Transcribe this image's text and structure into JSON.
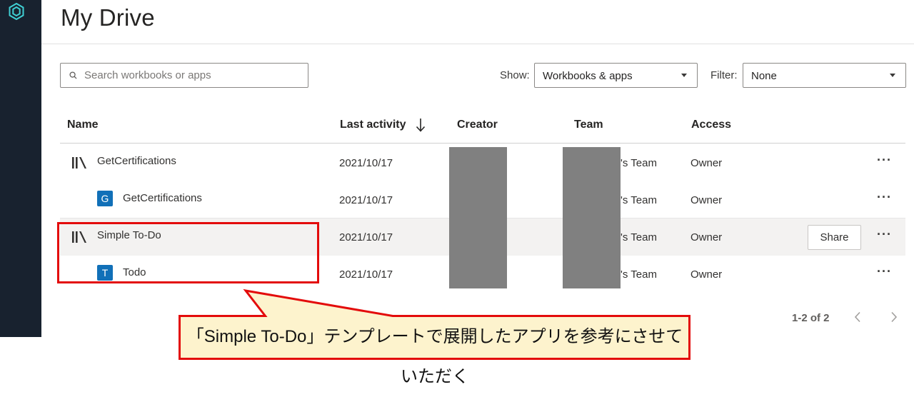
{
  "sidebar": {
    "logo_icon": "hexagon-logo-icon",
    "background": "#18222f"
  },
  "header": {
    "title": "My Drive"
  },
  "toolbar": {
    "search_placeholder": "Search workbooks or apps",
    "show_label": "Show:",
    "show_value": "Workbooks & apps",
    "filter_label": "Filter:",
    "filter_value": "None"
  },
  "table": {
    "columns": {
      "name": "Name",
      "last_activity": "Last activity",
      "creator": "Creator",
      "team": "Team",
      "access": "Access"
    },
    "sort_icon": "arrow-down-icon",
    "rows": [
      {
        "type": "workspace",
        "name": "GetCertifications",
        "last_activity": "2021/10/17",
        "team": "'s Team",
        "access": "Owner"
      },
      {
        "type": "app",
        "badge": "G",
        "name": "GetCertifications",
        "last_activity": "2021/10/17",
        "team": "'s Team",
        "access": "Owner"
      },
      {
        "type": "workspace",
        "name": "Simple To-Do",
        "last_activity": "2021/10/17",
        "team": "'s Team",
        "access": "Owner",
        "share_label": "Share"
      },
      {
        "type": "app",
        "badge": "T",
        "name": "Todo",
        "last_activity": "2021/10/17",
        "team": "'s Team",
        "access": "Owner"
      }
    ],
    "more_icon": "ellipsis-icon"
  },
  "pagination": {
    "range": "1-2 of 2"
  },
  "annotation": {
    "callout_text": "「Simple To-Do」テンプレートで展開したアプリを参考にさせていただく",
    "highlight_color": "#e30b0b",
    "callout_fill": "#fdf3cd"
  },
  "colors": {
    "app_badge": "#1170b8",
    "redaction": "#808080"
  }
}
